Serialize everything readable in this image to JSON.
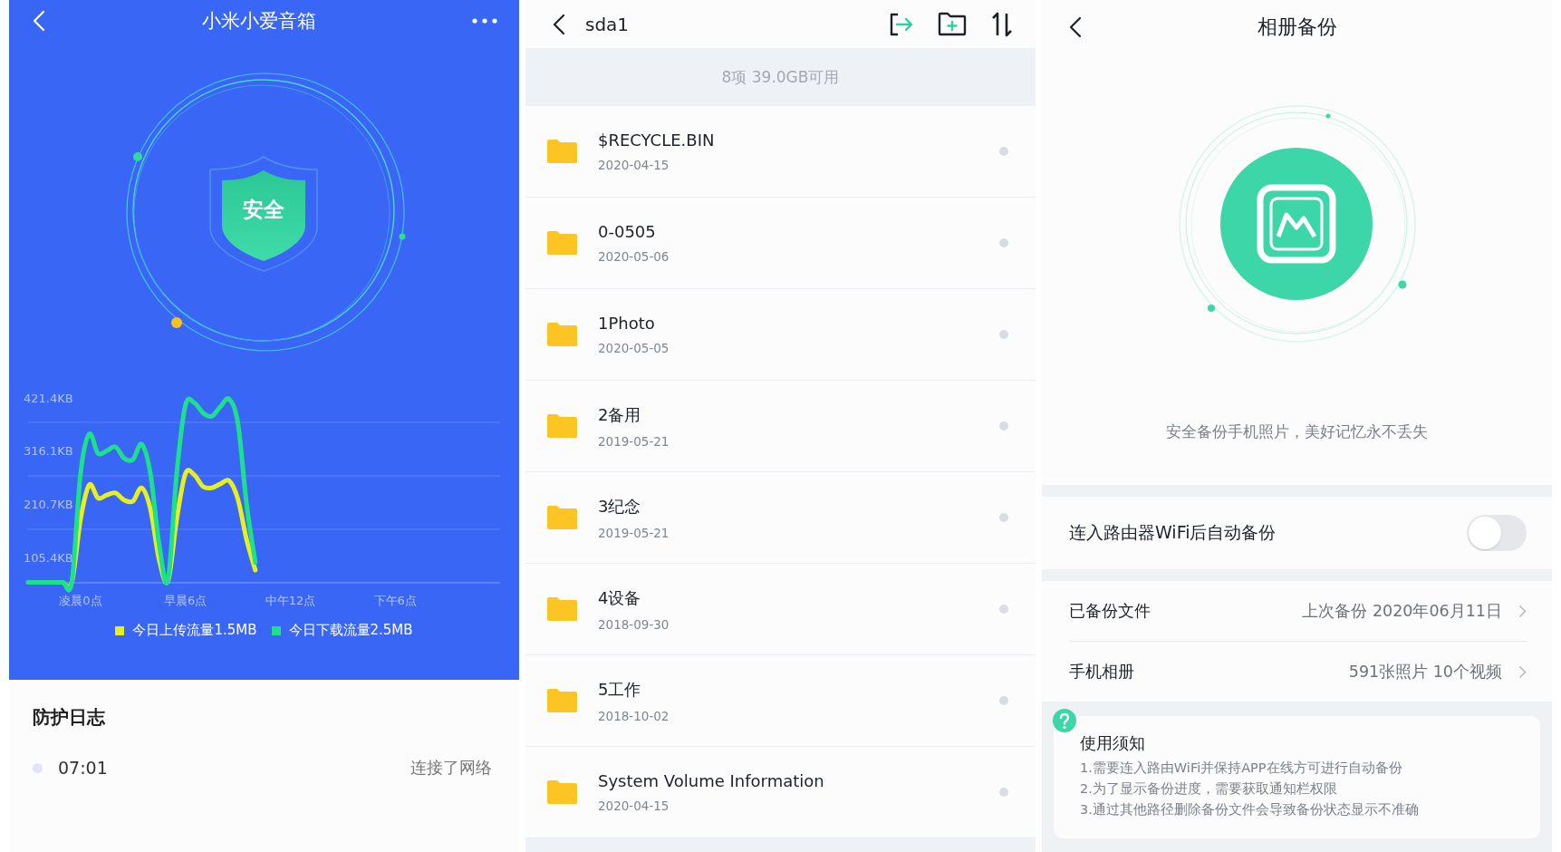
{
  "speaker_screen": {
    "title": "小米小爱音箱",
    "status_badge": "安全",
    "chart_data": {
      "type": "line",
      "ylim": [
        57,
        421.4
      ],
      "categories": [
        null,
        null,
        null,
        null,
        null,
        null,
        "凌晨0点",
        null,
        null,
        null,
        null,
        null,
        null,
        null,
        null,
        null,
        null,
        null,
        "早晨6点",
        null,
        null,
        null,
        null,
        null,
        null,
        null,
        null,
        null,
        null,
        null,
        "中午12点",
        null,
        null,
        null,
        null,
        null,
        null,
        null,
        null,
        null,
        null,
        null,
        "下午6点",
        null,
        null,
        null,
        null,
        null,
        null,
        null,
        null,
        null,
        null,
        null
      ],
      "series": [
        {
          "name": "今日上传流量1.5MB",
          "color": "#e6f01e",
          "values": [
            null,
            null,
            null,
            null,
            58,
            58,
            182,
            250,
            224,
            230,
            234,
            220,
            218,
            244,
            202,
            102,
            60,
            182,
            272,
            270,
            247,
            244,
            252,
            258,
            222,
            142,
            82,
            null,
            null,
            null,
            null,
            null,
            null,
            null,
            null,
            null,
            null,
            null,
            null,
            null,
            null,
            null,
            null,
            null,
            null,
            null,
            null,
            null,
            null,
            null,
            null,
            null,
            null,
            null
          ]
        },
        {
          "name": "今日下载流量2.5MB",
          "color": "#1ee08c",
          "values": [
            58,
            58,
            58,
            58,
            58,
            58,
            272,
            350,
            312,
            317,
            325,
            302,
            300,
            330,
            272,
            132,
            62,
            272,
            407,
            412,
            392,
            385,
            404,
            419,
            372,
            212,
            97,
            null,
            null,
            null,
            null,
            null,
            null,
            null,
            null,
            null,
            null,
            null,
            null,
            null,
            null,
            null,
            null,
            null,
            null,
            null,
            null,
            null,
            null,
            null,
            null,
            null,
            null,
            null
          ]
        }
      ],
      "yticks": [
        {
          "value": 105.4,
          "label": "105.4KB"
        },
        {
          "value": 210.7,
          "label": "210.7KB"
        },
        {
          "value": 316.1,
          "label": "316.1KB"
        },
        {
          "value": 421.4,
          "label": "421.4KB"
        }
      ]
    },
    "log": {
      "title": "防护日志",
      "entries": [
        {
          "time": "07:01",
          "event": "连接了网络"
        }
      ]
    }
  },
  "storage_screen": {
    "title": "sda1",
    "summary": "8项 39.0GB可用",
    "files": [
      {
        "name": "$RECYCLE.BIN",
        "date": "2020-04-15"
      },
      {
        "name": "0-0505",
        "date": "2020-05-06"
      },
      {
        "name": "1Photo",
        "date": "2020-05-05"
      },
      {
        "name": "2备用",
        "date": "2019-05-21"
      },
      {
        "name": "3纪念",
        "date": "2019-05-21"
      },
      {
        "name": "4设备",
        "date": "2018-09-30"
      },
      {
        "name": "5工作",
        "date": "2018-10-02"
      },
      {
        "name": "System Volume Information",
        "date": "2020-04-15"
      }
    ]
  },
  "album_backup_screen": {
    "title": "相册备份",
    "caption": "安全备份手机照片，美好记忆永不丢失",
    "auto_backup": {
      "label": "连入路由器WiFi后自动备份",
      "on": false
    },
    "rows": [
      {
        "label": "已备份文件",
        "value": "上次备份 2020年06月11日"
      },
      {
        "label": "手机相册",
        "value": "591张照片 10个视频"
      }
    ],
    "notice": {
      "title": "使用须知",
      "items": [
        "1.需要连入路由WiFi并保持APP在线方可进行自动备份",
        "2.为了显示备份进度，需要获取通知栏权限",
        "3.通过其他路径删除备份文件会导致备份状态显示不准确"
      ]
    }
  }
}
